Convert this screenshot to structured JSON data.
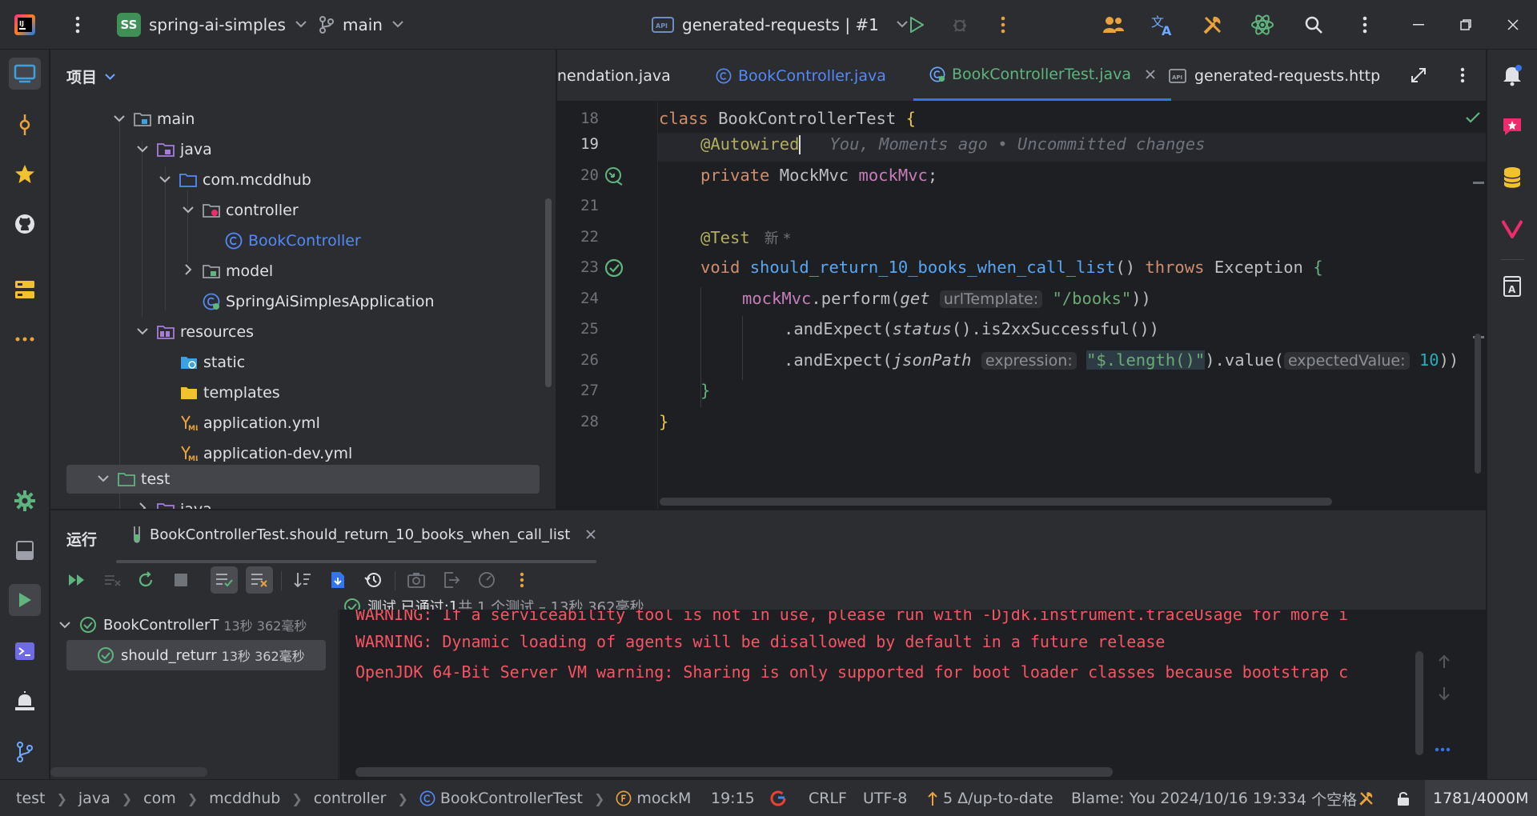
{
  "titlebar": {
    "project_badge": "SS",
    "project_name": "spring-ai-simples",
    "branch": "main",
    "run_config": "generated-requests | #1"
  },
  "project_panel": {
    "title": "项目",
    "tree": [
      {
        "label": "main"
      },
      {
        "label": "java"
      },
      {
        "label": "com.mcddhub"
      },
      {
        "label": "controller"
      },
      {
        "label": "BookController"
      },
      {
        "label": "model"
      },
      {
        "label": "SpringAiSimplesApplication"
      },
      {
        "label": "resources"
      },
      {
        "label": "static"
      },
      {
        "label": "templates"
      },
      {
        "label": "application.yml"
      },
      {
        "label": "application-dev.yml"
      },
      {
        "label": "test"
      },
      {
        "label": "java"
      }
    ]
  },
  "editor": {
    "tabs": [
      {
        "label": "nendation.java"
      },
      {
        "label": "BookController.java"
      },
      {
        "label": "BookControllerTest.java"
      },
      {
        "label": "generated-requests.http"
      }
    ],
    "line_numbers": [
      "18",
      "19",
      "20",
      "21",
      "22",
      "23",
      "24",
      "25",
      "26",
      "27",
      "28"
    ],
    "code": {
      "l18_kw": "class ",
      "l18_name": "BookControllerTest ",
      "l18_brace": "{",
      "l19_ann": "@Autowired",
      "l19_blame": "You, Moments ago • Uncommitted changes",
      "l20_kw": "private ",
      "l20_type": "MockMvc ",
      "l20_field": "mockMvc",
      "l20_semi": ";",
      "l22_ann": "@Test",
      "l22_hint": "新 *",
      "l23_kw": "void ",
      "l23_fn": "should_return_10_books_when_call_list",
      "l23_paren": "() ",
      "l23_throws": "throws ",
      "l23_exc": "Exception ",
      "l23_brace": "{",
      "l24_obj": "mockMvc",
      "l24_call": ".perform(",
      "l24_get": "get",
      "l24_hint": "urlTemplate:",
      "l24_str": "\"/books\"",
      "l24_close": "))",
      "l25_a": ".andExpect(",
      "l25_status": "status",
      "l25_b": "().is2xxSuccessful())",
      "l26_a": ".andExpect(",
      "l26_json": "jsonPath",
      "l26_hint1": "expression:",
      "l26_str": "\"$.length()\"",
      "l26_b": ").value(",
      "l26_hint2": "expectedValue:",
      "l26_num": "10",
      "l26_c": "))",
      "l27": "}",
      "l28": "}"
    }
  },
  "run_panel": {
    "title": "运行",
    "tab_label": "BookControllerTest.should_return_10_books_when_call_list",
    "summary_prefix": "测试 已通过: ",
    "summary_count": "1",
    "summary_rest": "共 1 个测试 – 13秒 362毫秒",
    "tests": [
      {
        "name": "BookControllerT",
        "time": "13秒 362毫秒"
      },
      {
        "name": "should_returr",
        "time": "13秒 362毫秒"
      }
    ],
    "console": [
      "WARNING: If a serviceability tool is not in use, please run with -Djdk.instrument.traceUsage for more i",
      "WARNING: Dynamic loading of agents will be disallowed by default in a future release",
      "OpenJDK 64-Bit Server VM warning: Sharing is only supported for boot loader classes because bootstrap c"
    ]
  },
  "statusbar": {
    "breadcrumb": [
      "test",
      "java",
      "com",
      "mcddhub",
      "controller",
      "BookControllerTest",
      "mockM"
    ],
    "position": "19:15",
    "line_sep": "CRLF",
    "encoding": "UTF-8",
    "vcs": "5 Δ/up-to-date",
    "blame": "Blame: You 2024/10/16 19:33",
    "indent": "4 个空格",
    "memory": "1781/4000M"
  },
  "colors": {
    "accent": "#3574f0",
    "success": "#5fb57d",
    "error": "#f75464"
  }
}
